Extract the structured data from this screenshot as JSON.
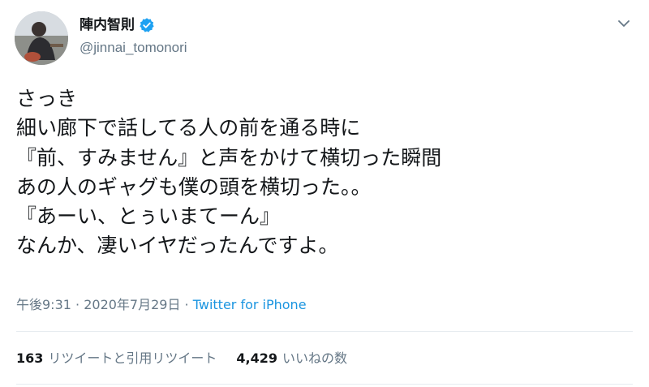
{
  "tweet": {
    "display_name": "陣内智則",
    "handle": "@jinnai_tomonori",
    "verified": true,
    "lines": [
      "さっき",
      "細い廊下で話してる人の前を通る時に",
      "『前、すみません』と声をかけて横切った瞬間",
      "あの人のギャグも僕の頭を横切った。。",
      "『あーい、とぅいまてーん』",
      "なんか、凄いイヤだったんですよ。"
    ],
    "time": "午後9:31",
    "separator": " · ",
    "date": "2020年7月29日",
    "separator2": " · ",
    "source": "Twitter for iPhone"
  },
  "stats": {
    "retweets_count": "163",
    "retweets_label": "リツイートと引用リツイート",
    "likes_count": "4,429",
    "likes_label": "いいねの数"
  },
  "colors": {
    "text": "#14171a",
    "secondary": "#657786",
    "link": "#1b95e0",
    "verified": "#1da1f2",
    "divider": "#e6ecf0"
  },
  "icons": {
    "verified": "verified-badge-icon",
    "menu": "chevron-down-icon"
  }
}
